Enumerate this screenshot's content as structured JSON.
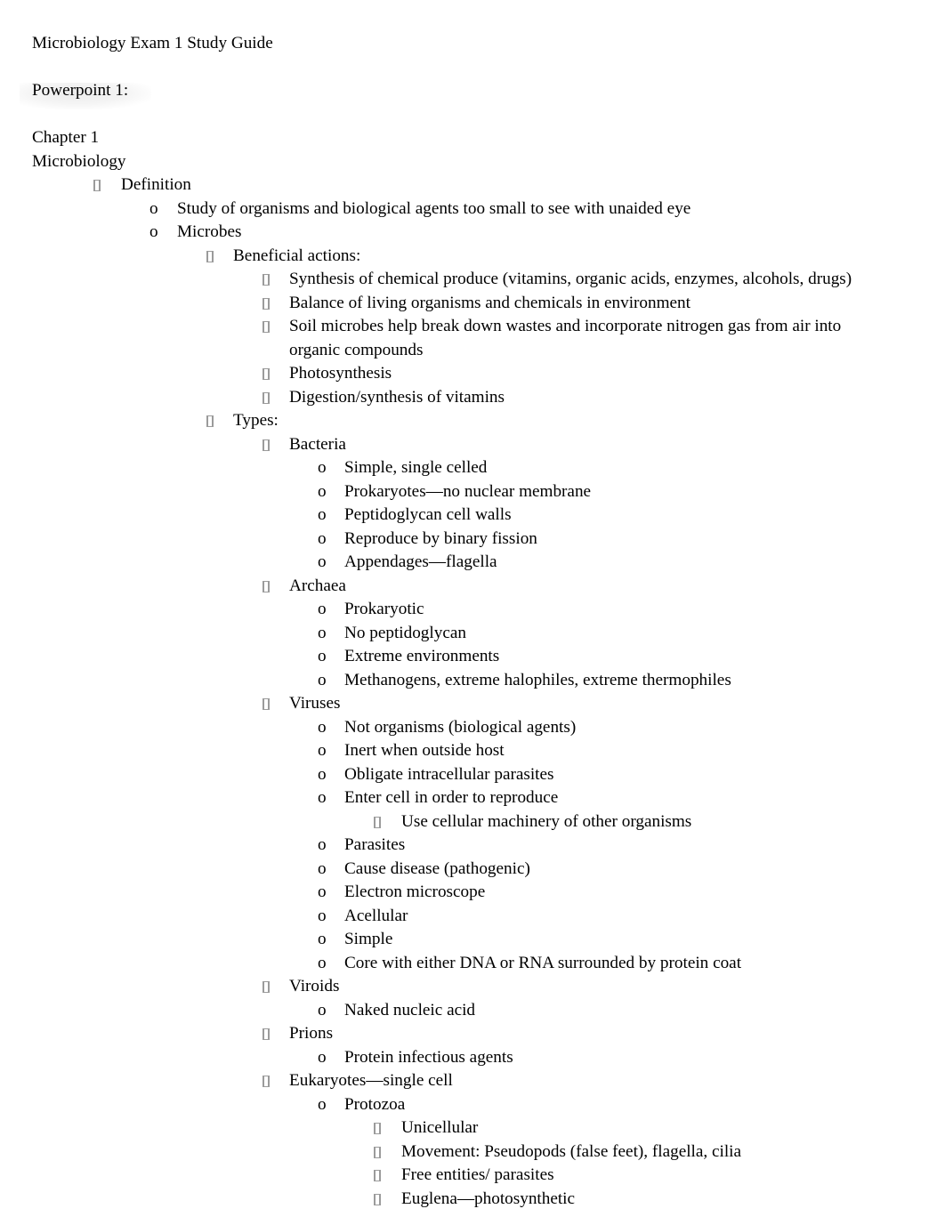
{
  "document": {
    "title": "Microbiology Exam 1 Study Guide",
    "section_label": "Powerpoint 1:",
    "chapter": "Chapter 1",
    "subject": "Microbiology"
  },
  "bullet_glyphs": {
    "level1": "missing-glyph-box",
    "level2": "o",
    "level3": "missing-glyph-box",
    "level4": "missing-glyph-box",
    "level5": "o",
    "level6": "missing-glyph-box"
  },
  "colors": {
    "page_background": "#ffffff",
    "text": "#000000",
    "tofu_border": "#9b9b9b",
    "highlight_shade": "rgba(0,0,0,0.07)"
  },
  "outline": [
    {
      "level": 1,
      "marker": "box",
      "text": "Definition"
    },
    {
      "level": 2,
      "marker": "o",
      "text": "Study of organisms and biological agents too small to see with unaided eye"
    },
    {
      "level": 2,
      "marker": "o",
      "text": "Microbes"
    },
    {
      "level": 3,
      "marker": "box",
      "text": "Beneficial actions:"
    },
    {
      "level": 4,
      "marker": "box",
      "text": "Synthesis of chemical produce (vitamins, organic acids, enzymes, alcohols, drugs)"
    },
    {
      "level": 4,
      "marker": "box",
      "text": "Balance of living organisms and chemicals in environment"
    },
    {
      "level": 4,
      "marker": "box",
      "text": "Soil microbes help break down wastes and incorporate nitrogen gas from air into organic compounds"
    },
    {
      "level": 4,
      "marker": "box",
      "text": "Photosynthesis"
    },
    {
      "level": 4,
      "marker": "box",
      "text": "Digestion/synthesis of vitamins"
    },
    {
      "level": 3,
      "marker": "box",
      "text": "Types:"
    },
    {
      "level": 4,
      "marker": "box",
      "text": "Bacteria"
    },
    {
      "level": 5,
      "marker": "o",
      "text": "Simple, single celled"
    },
    {
      "level": 5,
      "marker": "o",
      "text": "Prokaryotes—no nuclear membrane"
    },
    {
      "level": 5,
      "marker": "o",
      "text": "Peptidoglycan cell walls"
    },
    {
      "level": 5,
      "marker": "o",
      "text": "Reproduce by binary fission"
    },
    {
      "level": 5,
      "marker": "o",
      "text": "Appendages—flagella"
    },
    {
      "level": 4,
      "marker": "box",
      "text": "Archaea"
    },
    {
      "level": 5,
      "marker": "o",
      "text": "Prokaryotic"
    },
    {
      "level": 5,
      "marker": "o",
      "text": "No peptidoglycan"
    },
    {
      "level": 5,
      "marker": "o",
      "text": "Extreme environments"
    },
    {
      "level": 5,
      "marker": "o",
      "text": "Methanogens, extreme halophiles, extreme thermophiles"
    },
    {
      "level": 4,
      "marker": "box",
      "text": "Viruses"
    },
    {
      "level": 5,
      "marker": "o",
      "text": "Not organisms (biological agents)"
    },
    {
      "level": 5,
      "marker": "o",
      "text": "Inert when outside host"
    },
    {
      "level": 5,
      "marker": "o",
      "text": "Obligate intracellular parasites"
    },
    {
      "level": 5,
      "marker": "o",
      "text": "Enter cell in order to reproduce"
    },
    {
      "level": 6,
      "marker": "box",
      "text": "Use cellular machinery of other organisms"
    },
    {
      "level": 5,
      "marker": "o",
      "text": "Parasites"
    },
    {
      "level": 5,
      "marker": "o",
      "text": "Cause disease (pathogenic)"
    },
    {
      "level": 5,
      "marker": "o",
      "text": "Electron microscope"
    },
    {
      "level": 5,
      "marker": "o",
      "text": "Acellular"
    },
    {
      "level": 5,
      "marker": "o",
      "text": "Simple"
    },
    {
      "level": 5,
      "marker": "o",
      "text": "Core with either DNA or RNA surrounded by protein coat"
    },
    {
      "level": 4,
      "marker": "box",
      "text": "Viroids"
    },
    {
      "level": 5,
      "marker": "o",
      "text": "Naked nucleic acid"
    },
    {
      "level": 4,
      "marker": "box",
      "text": "Prions"
    },
    {
      "level": 5,
      "marker": "o",
      "text": "Protein infectious agents"
    },
    {
      "level": 4,
      "marker": "box",
      "text": "Eukaryotes—single cell"
    },
    {
      "level": 5,
      "marker": "o",
      "text": "Protozoa"
    },
    {
      "level": 6,
      "marker": "box",
      "text": "Unicellular"
    },
    {
      "level": 6,
      "marker": "box",
      "text": "Movement: Pseudopods (false feet), flagella, cilia"
    },
    {
      "level": 6,
      "marker": "box",
      "text": "Free entities/ parasites"
    },
    {
      "level": 6,
      "marker": "box",
      "text": "Euglena—photosynthetic"
    }
  ]
}
